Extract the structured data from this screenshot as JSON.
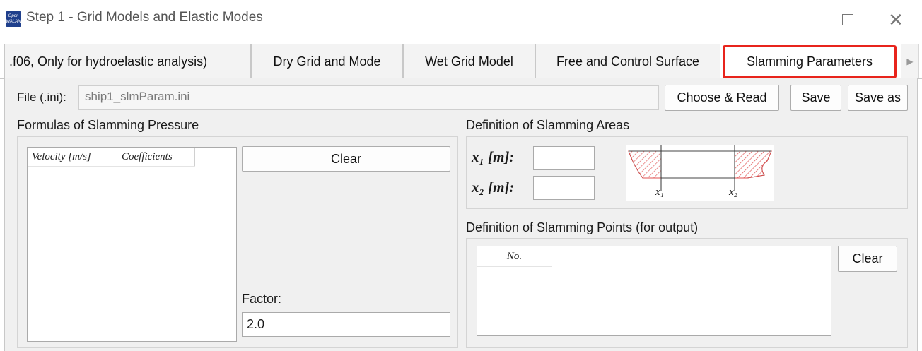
{
  "window": {
    "title": "Step 1 - Grid Models and Elastic Modes",
    "app_icon_text": [
      "Open",
      "WALAN"
    ],
    "controls": [
      "minimize-icon",
      "maximize-icon",
      "close-icon"
    ],
    "close_glyph": "✕"
  },
  "tabs": [
    {
      "label": ".f06, Only for hydroelastic analysis)"
    },
    {
      "label": "Dry Grid and Mode"
    },
    {
      "label": "Wet Grid Model"
    },
    {
      "label": "Free and Control Surface"
    },
    {
      "label": "Slamming Parameters",
      "selected": true
    }
  ],
  "tab_scroll_glyph": "▶",
  "highlight_color": "#e8241c",
  "file": {
    "label": "File (.ini):",
    "value": "ship1_slmParam.ini",
    "buttons": {
      "choose": "Choose & Read",
      "save": "Save",
      "save_as": "Save as"
    }
  },
  "formulas": {
    "title": "Formulas of Slamming Pressure",
    "columns": [
      "Velocity [m/s]",
      "Coefficients"
    ],
    "rows": [],
    "clear_label": "Clear",
    "factor_label": "Factor:",
    "factor_value": "2.0"
  },
  "areas": {
    "title": "Definition of Slamming Areas",
    "x1_label": "x₁ [m]:",
    "x2_label": "x₂ [m]:",
    "x1_value": "",
    "x2_value": "",
    "diagram_labels": [
      "x₁",
      "x₂"
    ]
  },
  "points": {
    "title": "Definition of Slamming Points (for output)",
    "columns": [
      "No."
    ],
    "rows": [],
    "clear_label": "Clear"
  }
}
